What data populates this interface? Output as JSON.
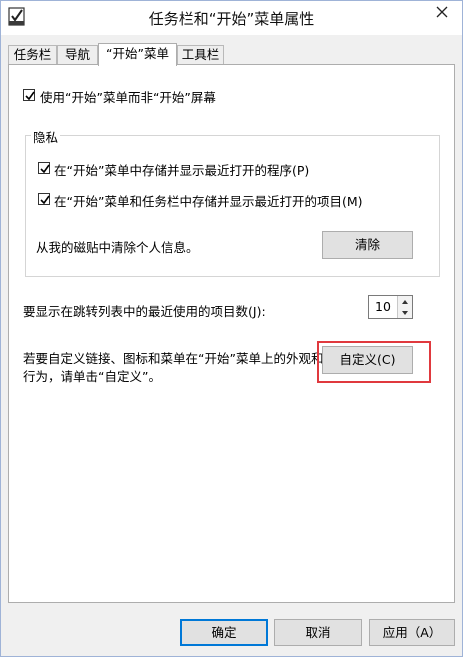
{
  "window": {
    "title": "任务栏和“开始”菜单属性"
  },
  "tabs": [
    {
      "label": "任务栏"
    },
    {
      "label": "导航"
    },
    {
      "label": "“开始”菜单"
    },
    {
      "label": "工具栏"
    }
  ],
  "start_menu": {
    "use_start_screen": {
      "label": "使用“开始”菜单而非“开始”屏幕",
      "checked": true
    },
    "privacy": {
      "title": "隐私",
      "store_recent_programs": {
        "label": "在“开始”菜单中存储并显示最近打开的程序(P)",
        "checked": true
      },
      "store_recent_items": {
        "label": "在“开始”菜单和任务栏中存储并显示最近打开的项目(M)",
        "checked": true
      },
      "clear_text": "从我的磁贴中清除个人信息。",
      "clear_button": "清除"
    },
    "jump_list": {
      "label": "要显示在跳转列表中的最近使用的项目数(J):",
      "value": "10"
    },
    "customize": {
      "text_line1": "若要自定义链接、图标和菜单在“开始”菜单上的外观和",
      "text_line2": "行为，请单击“自定义”。",
      "button": "自定义(C)"
    }
  },
  "footer": {
    "ok": "确定",
    "cancel": "取消",
    "apply": "应用（A）"
  },
  "colors": {
    "highlight": "#e0393e",
    "accent": "#0078d7"
  }
}
